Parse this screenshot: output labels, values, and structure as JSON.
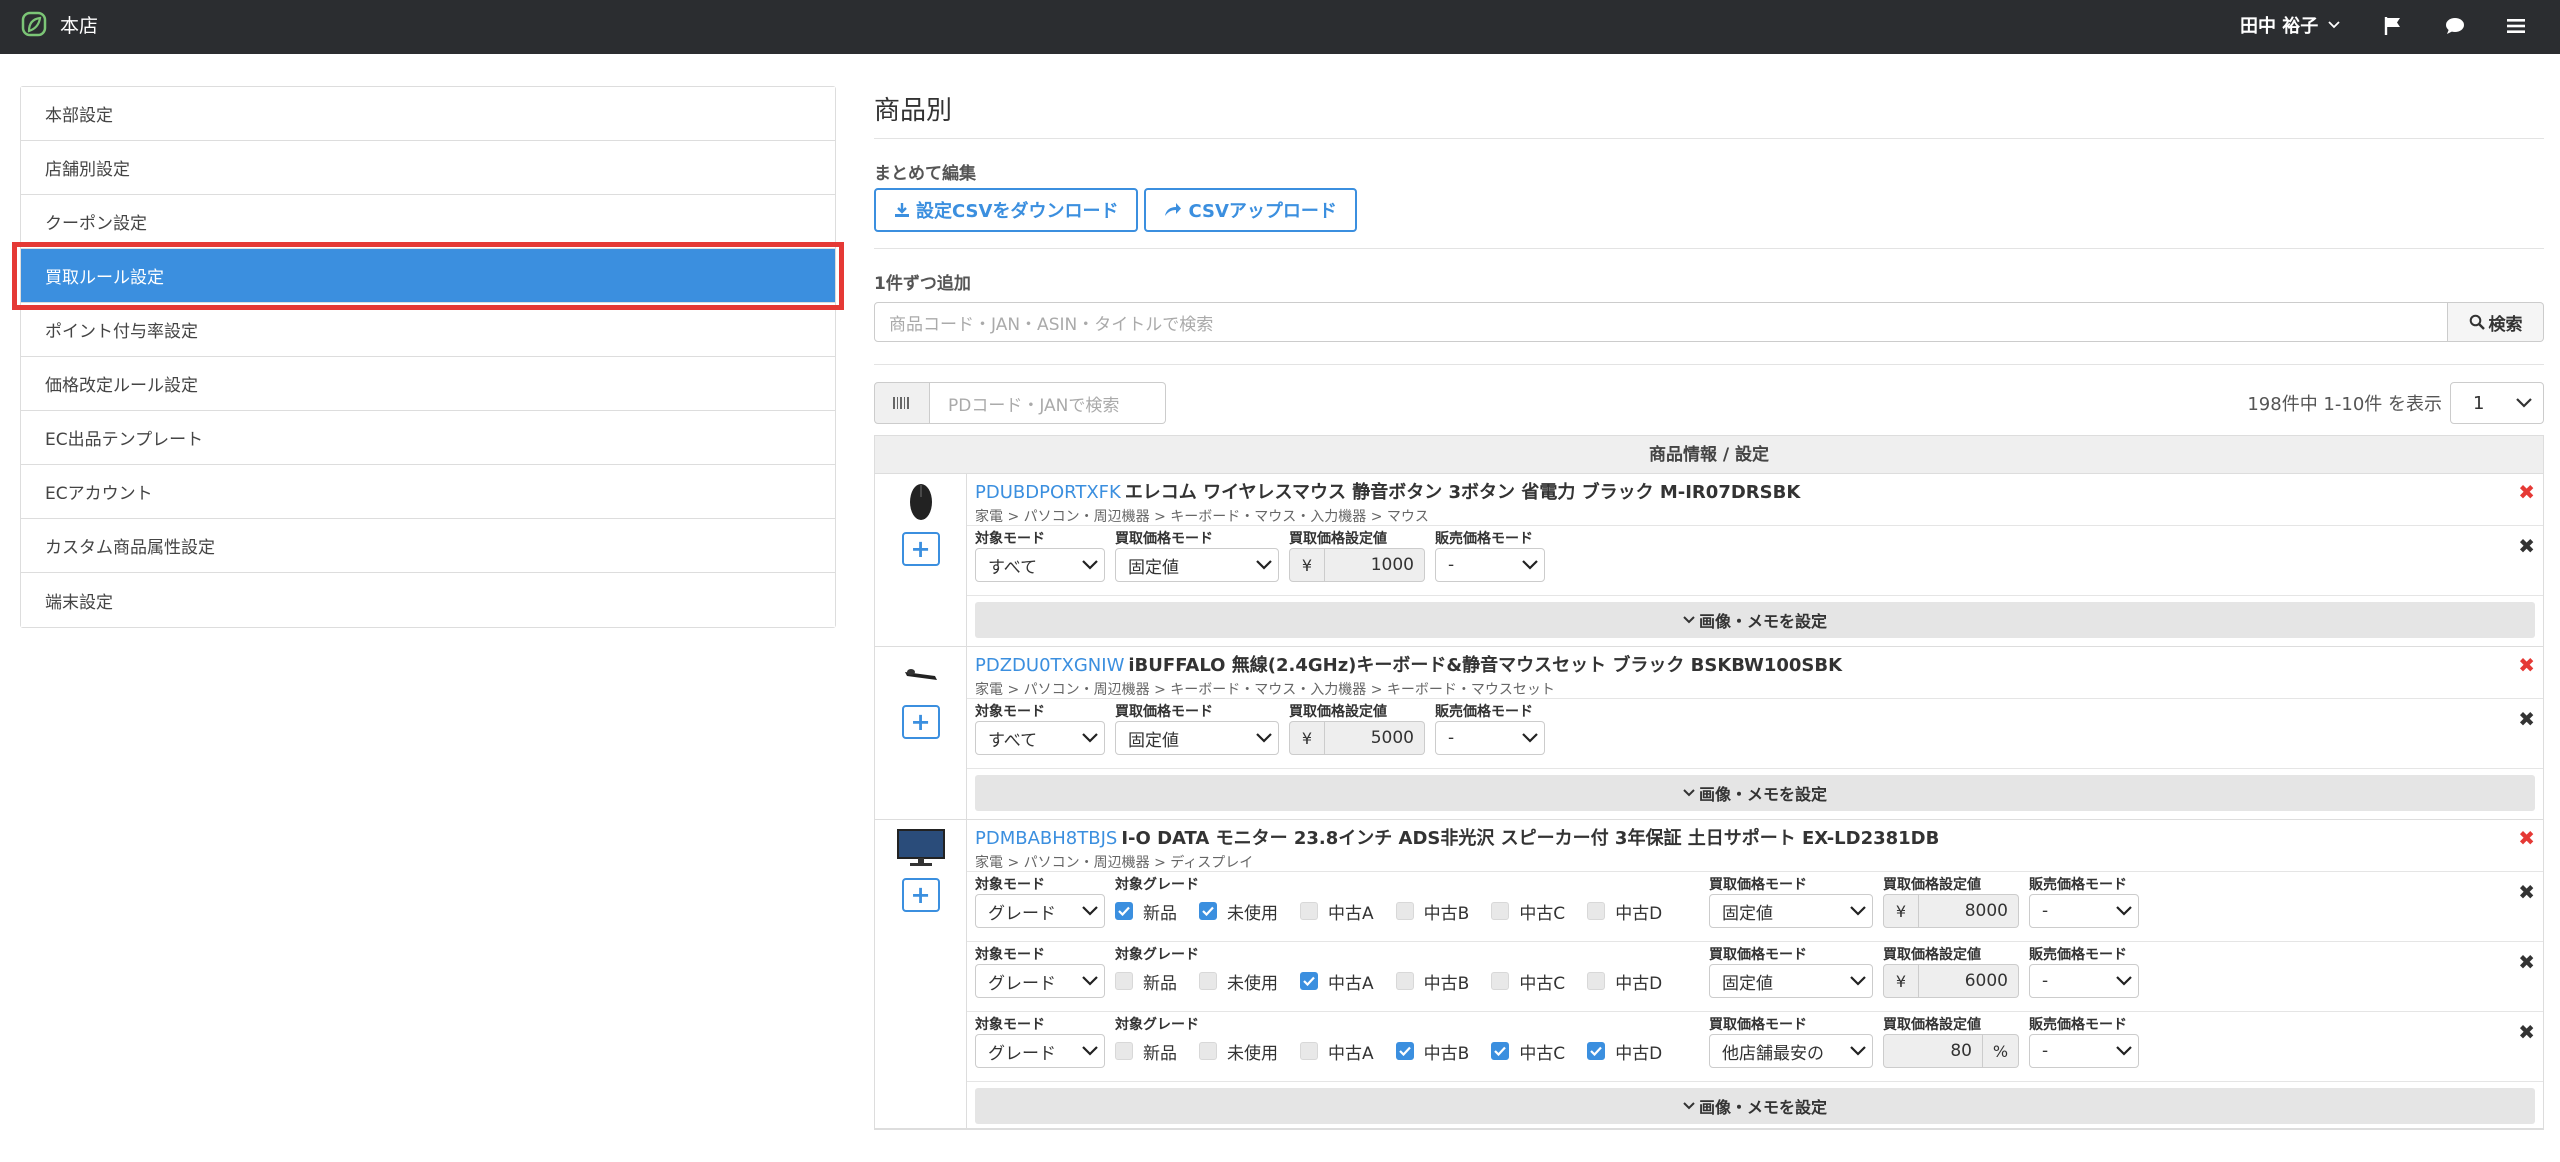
{
  "header": {
    "store_name": "本店",
    "user_name": "田中 裕子"
  },
  "icons": {
    "brand": "leaf-logo-icon",
    "flag": "flag-icon",
    "chat": "chat-bubble-icon",
    "menu": "hamburger-menu-icon"
  },
  "colors": {
    "accent": "#3b8fdf",
    "topbar": "#2b2d30",
    "highlight": "#e53935"
  },
  "sidebar": {
    "items": [
      {
        "label": "本部設定"
      },
      {
        "label": "店舗別設定"
      },
      {
        "label": "クーポン設定"
      },
      {
        "label": "買取ルール設定",
        "active": true
      },
      {
        "label": "ポイント付与率設定"
      },
      {
        "label": "価格改定ルール設定"
      },
      {
        "label": "EC出品テンプレート"
      },
      {
        "label": "ECアカウント"
      },
      {
        "label": "カスタム商品属性設定"
      },
      {
        "label": "端末設定"
      }
    ]
  },
  "main": {
    "title": "商品別",
    "bulk": {
      "label": "まとめて編集",
      "download_label": "設定CSVをダウンロード",
      "upload_label": "CSVアップロード"
    },
    "single": {
      "label": "1件ずつ追加",
      "search_placeholder": "商品コード・JAN・ASIN・タイトルで検索",
      "search_button": "検索"
    },
    "filter": {
      "pd_placeholder": "PDコード・JANで検索",
      "count_text": "198件中 1-10件 を表示",
      "page": "1"
    },
    "table_header": "商品情報 / 設定",
    "memo_label": "画像・メモを設定"
  },
  "labels": {
    "target_mode": "対象モード",
    "target_grade": "対象グレード",
    "buy_price_mode": "買取価格モード",
    "buy_price_value": "買取価格設定値",
    "sale_price_mode": "販売価格モード",
    "yen": "¥",
    "percent": "%"
  },
  "products": [
    {
      "code": "PDUBDPORTXFK",
      "title": "エレコム ワイヤレスマウス 静音ボタン 3ボタン 省電力 ブラック M-IR07DRSBK",
      "category": "家電 > パソコン・周辺機器 > キーボード・マウス・入力機器 > マウス",
      "rule": {
        "target_mode": "すべて",
        "buy_mode": "固定値",
        "value": "1000",
        "sale_mode": "-"
      }
    },
    {
      "code": "PDZDU0TXGNIW",
      "title": "iBUFFALO 無線(2.4GHz)キーボード&静音マウスセット ブラック BSKBW100SBK",
      "category": "家電 > パソコン・周辺機器 > キーボード・マウス・入力機器 > キーボード・マウスセット",
      "rule": {
        "target_mode": "すべて",
        "buy_mode": "固定値",
        "value": "5000",
        "sale_mode": "-"
      }
    },
    {
      "code": "PDMBABH8TBJS",
      "title": "I-O DATA モニター 23.8インチ ADS非光沢 スピーカー付 3年保証 土日サポート EX-LD2381DB",
      "category": "家電 > パソコン・周辺機器 > ディスプレイ",
      "grade_names": [
        "新品",
        "未使用",
        "中古A",
        "中古B",
        "中古C",
        "中古D"
      ],
      "rules": [
        {
          "target_mode": "グレード",
          "checked": [
            true,
            true,
            false,
            false,
            false,
            false
          ],
          "buy_mode": "固定値",
          "value": "8000",
          "sale_mode": "-"
        },
        {
          "target_mode": "グレード",
          "checked": [
            false,
            false,
            true,
            false,
            false,
            false
          ],
          "buy_mode": "固定値",
          "value": "6000",
          "sale_mode": "-"
        },
        {
          "target_mode": "グレード",
          "checked": [
            false,
            false,
            false,
            true,
            true,
            true
          ],
          "buy_mode": "他店舗最安の",
          "value": "80",
          "sale_mode": "-"
        }
      ]
    }
  ]
}
